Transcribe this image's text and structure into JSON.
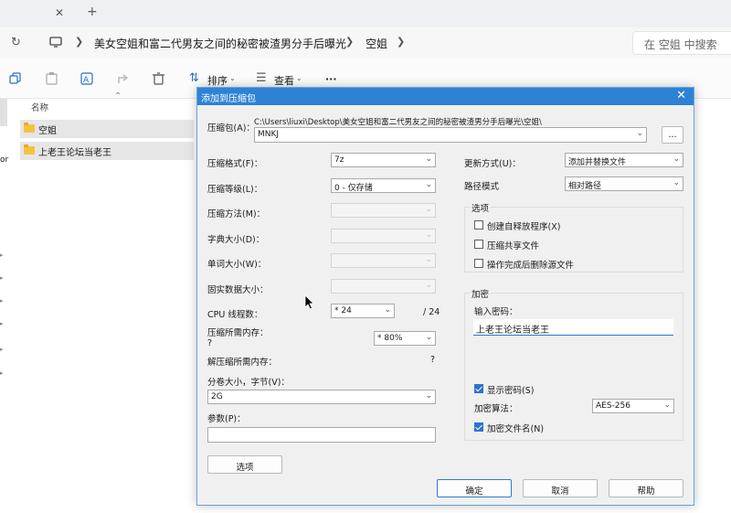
{
  "tab": {
    "close": "✕",
    "new": "+"
  },
  "address": {
    "crumbs": [
      "美女空姐和富二代男友之间的秘密被渣男分手后曝光",
      "空姐"
    ],
    "search_placeholder": "在 空姐 中搜索"
  },
  "toolbar": {
    "sort_label": "排序",
    "view_label": "查看",
    "more_label": "···"
  },
  "list": {
    "column_name": "名称",
    "items": [
      "空姐",
      "上老王论坛当老王"
    ],
    "side_fragment": "or"
  },
  "dialog": {
    "title": "添加到压缩包",
    "archive_label": "压缩包(A)：",
    "archive_path": "C:\\Users\\liuxi\\Desktop\\美女空姐和富二代男友之间的秘密被渣男分手后曝光\\空姐\\",
    "archive_name": "MNKJ",
    "browse_label": "...",
    "format_label": "压缩格式(F)：",
    "format_value": "7z",
    "level_label": "压缩等级(L)：",
    "level_value": "0 - 仅存储",
    "method_label": "压缩方法(M)：",
    "dict_label": "字典大小(D)：",
    "word_label": "单词大小(W)：",
    "solid_label": "固实数据大小：",
    "cpu_label": "CPU 线程数：",
    "cpu_value": "* 24",
    "cpu_total": "/ 24",
    "mem_comp_label": "压缩所需内存：",
    "mem_comp_value": "?",
    "mem_pct_value": "* 80%",
    "mem_decomp_label": "解压缩所需内存：",
    "mem_decomp_value": "?",
    "split_label": "分卷大小，字节(V)：",
    "split_value": "2G",
    "params_label": "参数(P)：",
    "params_value": "",
    "options_button": "选项",
    "update_label": "更新方式(U)：",
    "update_value": "添加并替换文件",
    "path_label": "路径模式",
    "path_value": "相对路径",
    "options_group": "选项",
    "opt_sfx": "创建自释放程序(X)",
    "opt_shared": "压缩共享文件",
    "opt_delete": "操作完成后删除源文件",
    "enc_group": "加密",
    "pwd_label": "输入密码：",
    "pwd_value": "上老王论坛当老王",
    "show_pwd": "显示密码(S)",
    "enc_method_label": "加密算法：",
    "enc_method_value": "AES-256",
    "enc_names": "加密文件名(N)",
    "ok": "确定",
    "cancel": "取消",
    "help": "帮助"
  }
}
